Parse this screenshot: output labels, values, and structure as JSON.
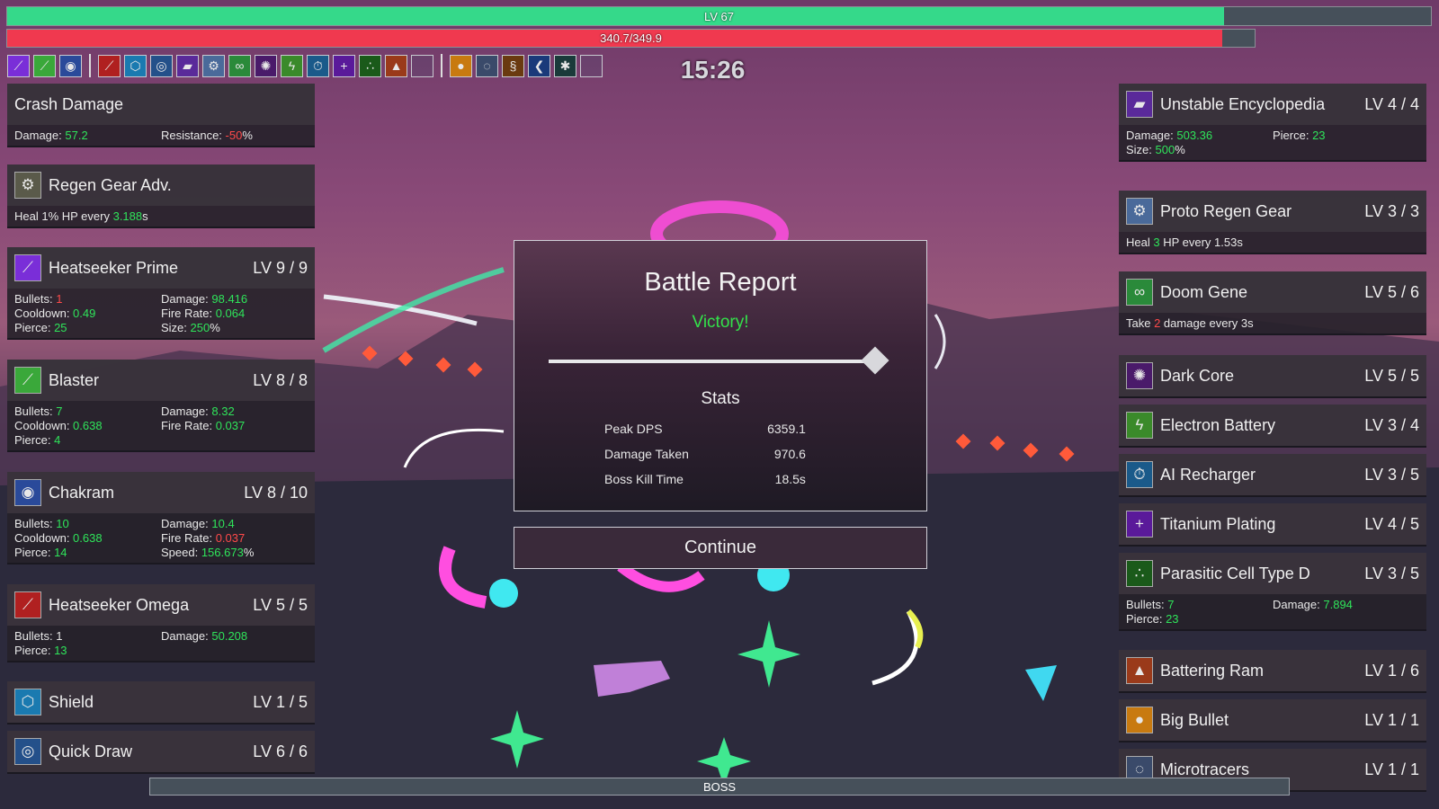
{
  "hud": {
    "level_text": "LV 67",
    "level_progress": 0.855,
    "hp_text": "340.7/349.9",
    "hp_progress": 0.974,
    "timer": "15:26",
    "boss_label": "BOSS"
  },
  "colors": {
    "xp_bar": "#35d98a",
    "hp_bar": "#f0394f",
    "green": "#2fe45a",
    "red": "#ff4a4a"
  },
  "weapon_slots": [
    {
      "icon": "purple-beam-icon",
      "color": "#7a2ed8",
      "glyph": "⟋"
    },
    {
      "icon": "green-laser-icon",
      "color": "#3aa83a",
      "glyph": "⟋"
    },
    {
      "icon": "blue-chakram-icon",
      "color": "#2a4a9a",
      "glyph": "◉"
    }
  ],
  "item_slots": [
    {
      "icon": "red-missile-icon",
      "color": "#b02020",
      "glyph": "⟋"
    },
    {
      "icon": "shield-icon",
      "color": "#1a7ab0",
      "glyph": "⬡"
    },
    {
      "icon": "quick-draw-icon",
      "color": "#24508a",
      "glyph": "◎"
    },
    {
      "icon": "encyclopedia-icon",
      "color": "#5a2a9a",
      "glyph": "▰"
    },
    {
      "icon": "regen-gear-icon",
      "color": "#4a6a9a",
      "glyph": "⚙"
    },
    {
      "icon": "doom-gene-icon",
      "color": "#2a8a3a",
      "glyph": "∞"
    },
    {
      "icon": "dark-core-icon",
      "color": "#4a1a6a",
      "glyph": "✺"
    },
    {
      "icon": "battery-icon",
      "color": "#3a8a2a",
      "glyph": "ϟ"
    },
    {
      "icon": "recharger-icon",
      "color": "#1a5a8a",
      "glyph": "⏱"
    },
    {
      "icon": "titanium-plus-icon",
      "color": "#5a1a9a",
      "glyph": "+"
    },
    {
      "icon": "parasitic-cell-icon",
      "color": "#1a5a1a",
      "glyph": "∴"
    },
    {
      "icon": "battering-ram-icon",
      "color": "#9a3a1a",
      "glyph": "▲"
    },
    {
      "icon": "empty-slot-icon",
      "color": "",
      "glyph": ""
    }
  ],
  "extra_slots": [
    {
      "icon": "big-bullet-icon",
      "color": "#c87a10",
      "glyph": "●"
    },
    {
      "icon": "microtracers-icon",
      "color": "#3a4a6a",
      "glyph": "◌"
    },
    {
      "icon": "orange-circuit-icon",
      "color": "#6a3a10",
      "glyph": "§"
    },
    {
      "icon": "blue-arrow-icon",
      "color": "#1a3a7a",
      "glyph": "❮"
    },
    {
      "icon": "dark-splat-icon",
      "color": "#1a3a3a",
      "glyph": "✱"
    },
    {
      "icon": "empty-slot-icon",
      "color": "",
      "glyph": ""
    }
  ],
  "left_panels": [
    {
      "name": "Crash Damage",
      "level": "",
      "icon": "",
      "stats": [
        {
          "label": "Damage: ",
          "value": "57.2",
          "suffix": "",
          "color": "g"
        },
        {
          "label": "Resistance: ",
          "value": "-50",
          "suffix": "%",
          "color": "r"
        }
      ]
    },
    {
      "name": "Regen Gear Adv.",
      "level": "",
      "icon": "regen-gear-icon",
      "glyph": "⚙",
      "ic_color": "#5a5a4a",
      "stats": [
        {
          "label": "Heal 1% HP every ",
          "value": "3.188",
          "suffix": "s",
          "color": "g",
          "full": true
        }
      ]
    },
    {
      "name": "Heatseeker Prime",
      "level": "LV 9 / 9",
      "icon": "purple-beam-icon",
      "glyph": "⟋",
      "ic_color": "#7a2ed8",
      "stats": [
        {
          "label": "Bullets: ",
          "value": "1",
          "suffix": "",
          "color": "r"
        },
        {
          "label": "Damage: ",
          "value": "98.416",
          "suffix": "",
          "color": "g"
        },
        {
          "label": "Cooldown: ",
          "value": "0.49",
          "suffix": "",
          "color": "g"
        },
        {
          "label": "Fire Rate: ",
          "value": "0.064",
          "suffix": "",
          "color": "g"
        },
        {
          "label": "Pierce: ",
          "value": "25",
          "suffix": "",
          "color": "g"
        },
        {
          "label": "Size: ",
          "value": "250",
          "suffix": "%",
          "color": "g"
        }
      ]
    },
    {
      "name": "Blaster",
      "level": "LV 8 / 8",
      "icon": "green-laser-icon",
      "glyph": "⟋",
      "ic_color": "#3aa83a",
      "stats": [
        {
          "label": "Bullets: ",
          "value": "7",
          "suffix": "",
          "color": "g"
        },
        {
          "label": "Damage: ",
          "value": "8.32",
          "suffix": "",
          "color": "g"
        },
        {
          "label": "Cooldown: ",
          "value": "0.638",
          "suffix": "",
          "color": "g"
        },
        {
          "label": "Fire Rate: ",
          "value": "0.037",
          "suffix": "",
          "color": "g"
        },
        {
          "label": "Pierce: ",
          "value": "4",
          "suffix": "",
          "color": "g"
        }
      ]
    },
    {
      "name": "Chakram",
      "level": "LV 8 / 10",
      "icon": "blue-chakram-icon",
      "glyph": "◉",
      "ic_color": "#2a4a9a",
      "stats": [
        {
          "label": "Bullets: ",
          "value": "10",
          "suffix": "",
          "color": "g"
        },
        {
          "label": "Damage: ",
          "value": "10.4",
          "suffix": "",
          "color": "g"
        },
        {
          "label": "Cooldown: ",
          "value": "0.638",
          "suffix": "",
          "color": "g"
        },
        {
          "label": "Fire Rate: ",
          "value": "0.037",
          "suffix": "",
          "color": "r"
        },
        {
          "label": "Pierce: ",
          "value": "14",
          "suffix": "",
          "color": "g"
        },
        {
          "label": "Speed: ",
          "value": "156.673",
          "suffix": "%",
          "color": "g"
        }
      ]
    },
    {
      "name": "Heatseeker Omega",
      "level": "LV 5 / 5",
      "icon": "red-missile-icon",
      "glyph": "⟋",
      "ic_color": "#b02020",
      "stats": [
        {
          "label": "Bullets: ",
          "value": "1",
          "suffix": "",
          "color": ""
        },
        {
          "label": "Damage: ",
          "value": "50.208",
          "suffix": "",
          "color": "g"
        },
        {
          "label": "Pierce: ",
          "value": "13",
          "suffix": "",
          "color": "g"
        }
      ]
    },
    {
      "name": "Shield",
      "level": "LV 1 / 5",
      "icon": "shield-icon",
      "glyph": "⬡",
      "ic_color": "#1a7ab0",
      "stats": []
    },
    {
      "name": "Quick Draw",
      "level": "LV 6 / 6",
      "icon": "quick-draw-icon",
      "glyph": "◎",
      "ic_color": "#24508a",
      "stats": []
    }
  ],
  "right_panels": [
    {
      "name": "Unstable Encyclopedia",
      "level": "LV 4 / 4",
      "icon": "encyclopedia-icon",
      "glyph": "▰",
      "ic_color": "#5a2a9a",
      "stats": [
        {
          "label": "Damage: ",
          "value": "503.36",
          "suffix": "",
          "color": "g"
        },
        {
          "label": "Pierce: ",
          "value": "23",
          "suffix": "",
          "color": "g"
        },
        {
          "label": "Size: ",
          "value": "500",
          "suffix": "%",
          "color": "g"
        }
      ]
    },
    {
      "name": "Proto Regen Gear",
      "level": "LV 3 / 3",
      "icon": "regen-gear-icon",
      "glyph": "⚙",
      "ic_color": "#4a6a9a",
      "stats": [
        {
          "label": "Heal ",
          "value": "3",
          "suffix": " HP every 1.53s",
          "color": "g",
          "full": true
        }
      ]
    },
    {
      "name": "Doom Gene",
      "level": "LV 5 / 6",
      "icon": "doom-gene-icon",
      "glyph": "∞",
      "ic_color": "#2a8a3a",
      "stats": [
        {
          "label": "Take ",
          "value": "2",
          "suffix": " damage every 3s",
          "color": "r",
          "full": true
        }
      ]
    },
    {
      "name": "Dark Core",
      "level": "LV 5 / 5",
      "icon": "dark-core-icon",
      "glyph": "✺",
      "ic_color": "#4a1a6a",
      "stats": []
    },
    {
      "name": "Electron Battery",
      "level": "LV 3 / 4",
      "icon": "battery-icon",
      "glyph": "ϟ",
      "ic_color": "#3a8a2a",
      "stats": []
    },
    {
      "name": "AI Recharger",
      "level": "LV 3 / 5",
      "icon": "recharger-icon",
      "glyph": "⏱",
      "ic_color": "#1a5a8a",
      "stats": []
    },
    {
      "name": "Titanium Plating",
      "level": "LV 4 / 5",
      "icon": "titanium-plus-icon",
      "glyph": "+",
      "ic_color": "#5a1a9a",
      "stats": []
    },
    {
      "name": "Parasitic Cell Type D",
      "level": "LV 3 / 5",
      "icon": "parasitic-cell-icon",
      "glyph": "∴",
      "ic_color": "#1a5a1a",
      "stats": [
        {
          "label": "Bullets: ",
          "value": "7",
          "suffix": "",
          "color": "g"
        },
        {
          "label": "Damage: ",
          "value": "7.894",
          "suffix": "",
          "color": "g"
        },
        {
          "label": "Pierce: ",
          "value": "23",
          "suffix": "",
          "color": "g"
        }
      ]
    },
    {
      "name": "Battering Ram",
      "level": "LV 1 / 6",
      "icon": "battering-ram-icon",
      "glyph": "▲",
      "ic_color": "#9a3a1a",
      "stats": []
    },
    {
      "name": "Big Bullet",
      "level": "LV 1 / 1",
      "icon": "big-bullet-icon",
      "glyph": "●",
      "ic_color": "#c87a10",
      "stats": []
    },
    {
      "name": "Microtracers",
      "level": "LV 1 / 1",
      "icon": "microtracers-icon",
      "glyph": "◌",
      "ic_color": "#3a4a6a",
      "stats": []
    }
  ],
  "report": {
    "title": "Battle Report",
    "result": "Victory!",
    "stats_heading": "Stats",
    "rows": [
      {
        "label": "Peak DPS",
        "value": "6359.1"
      },
      {
        "label": "Damage Taken",
        "value": "970.6"
      },
      {
        "label": "Boss Kill Time",
        "value": "18.5s"
      }
    ],
    "continue_label": "Continue"
  }
}
